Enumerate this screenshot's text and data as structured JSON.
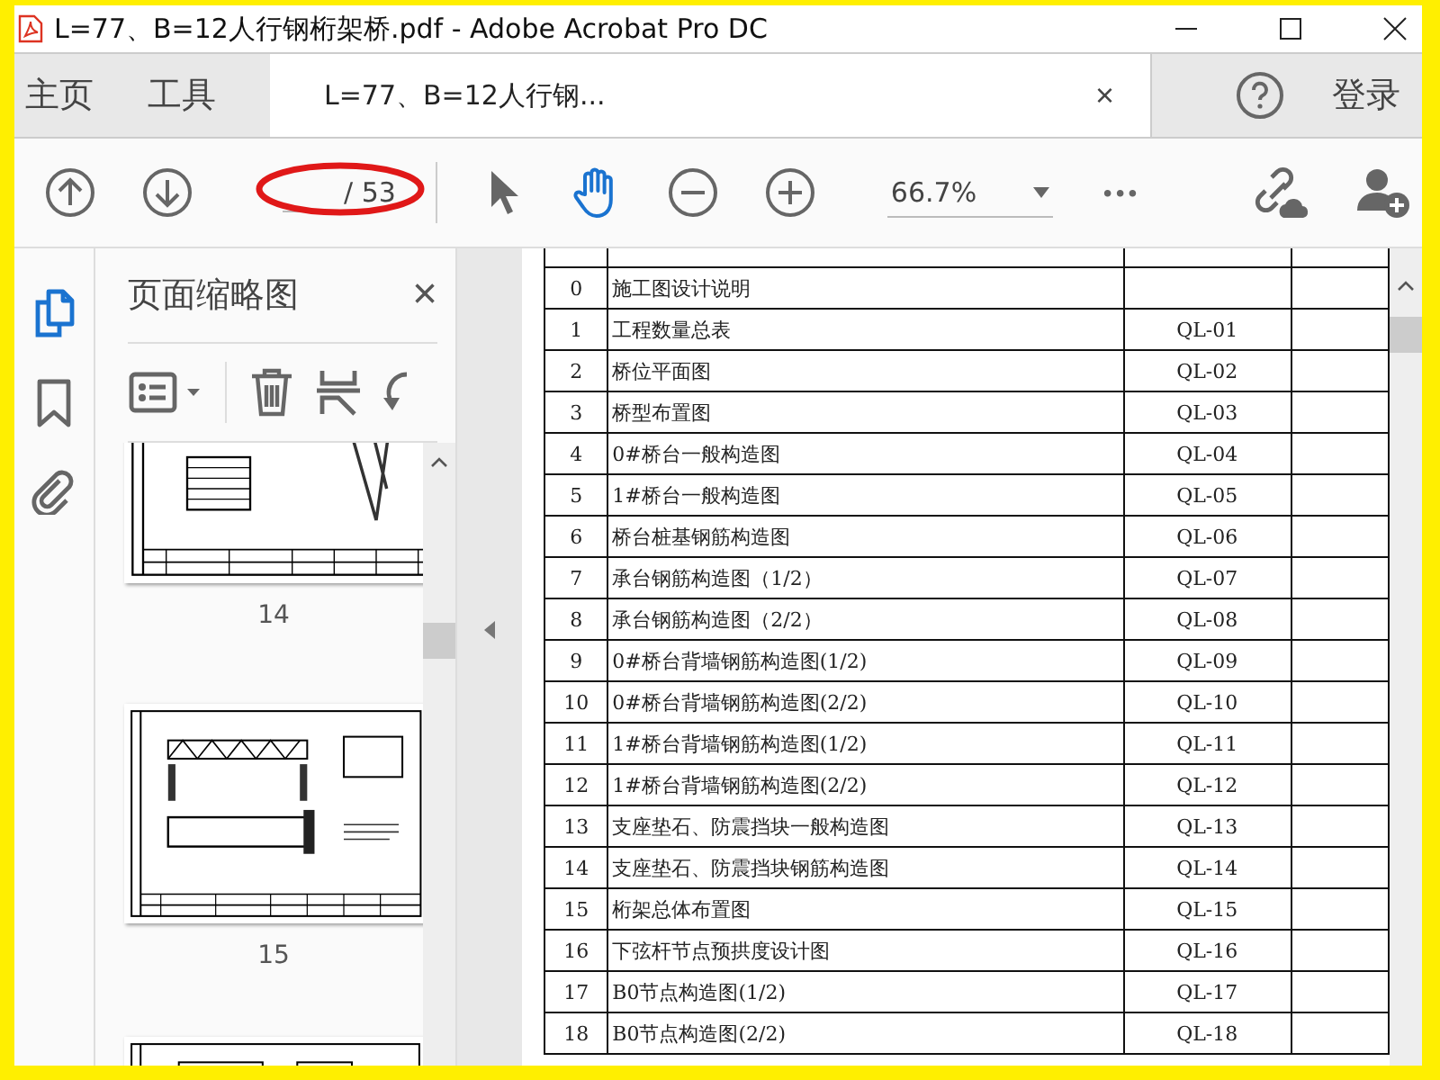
{
  "window": {
    "title": "L=77、B=12人行钢桁架桥.pdf - Adobe Acrobat Pro DC"
  },
  "nav_tabs": [
    {
      "label": "主页"
    },
    {
      "label": "工具"
    }
  ],
  "document_tab": {
    "label": "L=77、B=12人行钢...",
    "close": "×"
  },
  "sign_in": "登录",
  "toolbar": {
    "page_total": "/ 53",
    "zoom": "66.7%",
    "more": "•••"
  },
  "annotation": {
    "kind": "ellipse"
  },
  "rail": [
    {
      "kind": "pages",
      "selected": true
    },
    {
      "kind": "bookmark",
      "selected": false
    },
    {
      "kind": "attachment",
      "selected": false
    }
  ],
  "thumbnail_panel": {
    "title": "页面缩略图",
    "close": "×",
    "pages": [
      {
        "kind": "plan",
        "label": "14"
      },
      {
        "kind": "elevation",
        "label": "15"
      },
      {
        "kind": "cut"
      }
    ]
  },
  "table": {
    "rows": [
      {
        "no": "0",
        "name": "施工图设计说明"
      },
      {
        "no": "1",
        "name": "工程数量总表",
        "code": "QL-01"
      },
      {
        "no": "2",
        "name": "桥位平面图",
        "code": "QL-02"
      },
      {
        "no": "3",
        "name": "桥型布置图",
        "code": "QL-03"
      },
      {
        "no": "4",
        "name": "0#桥台一般构造图",
        "code": "QL-04"
      },
      {
        "no": "5",
        "name": "1#桥台一般构造图",
        "code": "QL-05"
      },
      {
        "no": "6",
        "name": "桥台桩基钢筋构造图",
        "code": "QL-06"
      },
      {
        "no": "7",
        "name": "承台钢筋构造图（1/2）",
        "code": "QL-07"
      },
      {
        "no": "8",
        "name": "承台钢筋构造图（2/2）",
        "code": "QL-08"
      },
      {
        "no": "9",
        "name": "0#桥台背墙钢筋构造图(1/2)",
        "code": "QL-09"
      },
      {
        "no": "10",
        "name": "0#桥台背墙钢筋构造图(2/2)",
        "code": "QL-10"
      },
      {
        "no": "11",
        "name": "1#桥台背墙钢筋构造图(1/2)",
        "code": "QL-11"
      },
      {
        "no": "12",
        "name": "1#桥台背墙钢筋构造图(2/2)",
        "code": "QL-12"
      },
      {
        "no": "13",
        "name": "支座垫石、防震挡块一般构造图",
        "code": "QL-13"
      },
      {
        "no": "14",
        "name": "支座垫石、防震挡块钢筋构造图",
        "code": "QL-14"
      },
      {
        "no": "15",
        "name": "桁架总体布置图",
        "code": "QL-15"
      },
      {
        "no": "16",
        "name": "下弦杆节点预拱度设计图",
        "code": "QL-16"
      },
      {
        "no": "17",
        "name": "B0节点构造图(1/2)",
        "code": "QL-17"
      },
      {
        "no": "18",
        "name": "B0节点构造图(2/2)",
        "code": "QL-18"
      }
    ]
  }
}
